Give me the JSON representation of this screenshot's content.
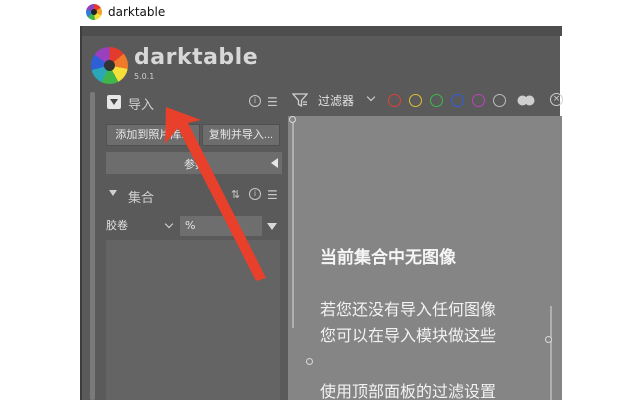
{
  "window": {
    "title": "darktable"
  },
  "logo": {
    "name": "darktable",
    "version": "5.0.1"
  },
  "import_module": {
    "label": "导入",
    "add_button": "添加到照片库...",
    "copy_button": "复制并导入...",
    "params_label": "参数"
  },
  "collections_module": {
    "label": "集合",
    "field_label": "胶卷",
    "field_value": "%"
  },
  "filterbar": {
    "label": "过滤器",
    "color_labels": [
      {
        "name": "red",
        "color": "#e0403a"
      },
      {
        "name": "yellow",
        "color": "#e0c030"
      },
      {
        "name": "green",
        "color": "#40b84a"
      },
      {
        "name": "blue",
        "color": "#3060e0"
      },
      {
        "name": "purple",
        "color": "#c040c0"
      },
      {
        "name": "gray",
        "color": "#bdbdbd"
      }
    ]
  },
  "center": {
    "title": "当前集合中无图像",
    "line1": "若您还没有导入任何图像",
    "line2": "您可以在导入模块做这些",
    "line3": "使用顶部面板的过滤设置"
  },
  "annotation": {
    "color": "#e8402a"
  }
}
